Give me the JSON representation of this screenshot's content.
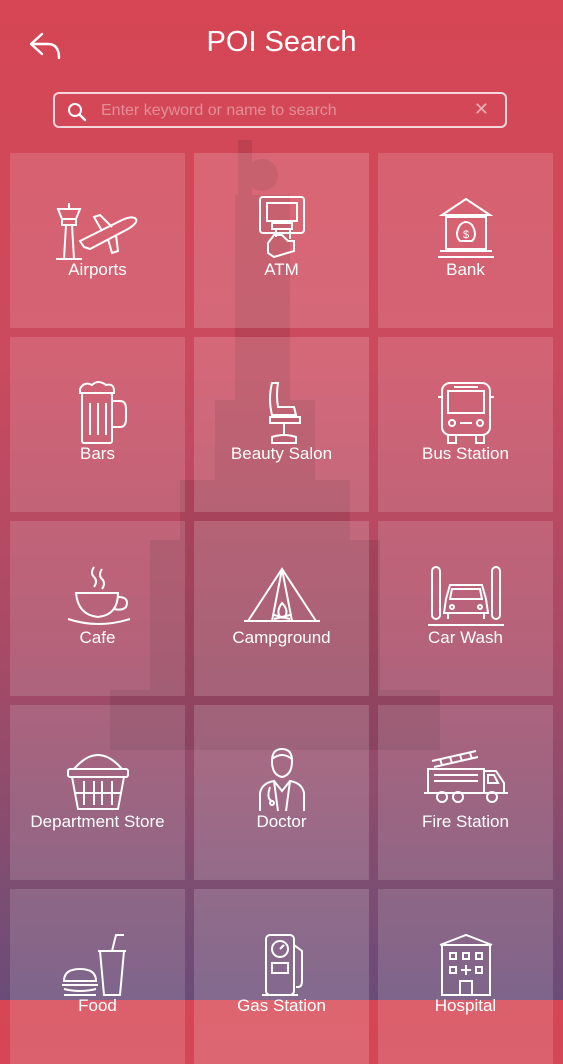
{
  "header": {
    "title": "POI Search"
  },
  "search": {
    "placeholder": "Enter keyword or name to search",
    "clear_label": "✕"
  },
  "categories": [
    {
      "label": "Airports",
      "icon": "airport-icon"
    },
    {
      "label": "ATM",
      "icon": "atm-icon"
    },
    {
      "label": "Bank",
      "icon": "bank-icon"
    },
    {
      "label": "Bars",
      "icon": "beer-mug-icon"
    },
    {
      "label": "Beauty Salon",
      "icon": "salon-chair-icon"
    },
    {
      "label": "Bus Station",
      "icon": "bus-icon"
    },
    {
      "label": "Cafe",
      "icon": "coffee-cup-icon"
    },
    {
      "label": "Campground",
      "icon": "tent-icon"
    },
    {
      "label": "Car Wash",
      "icon": "car-wash-icon"
    },
    {
      "label": "Department Store",
      "icon": "basket-icon"
    },
    {
      "label": "Doctor",
      "icon": "doctor-icon"
    },
    {
      "label": "Fire Station",
      "icon": "fire-truck-icon"
    },
    {
      "label": "Food",
      "icon": "fast-food-icon"
    },
    {
      "label": "Gas Station",
      "icon": "gas-pump-icon"
    },
    {
      "label": "Hospital",
      "icon": "hospital-icon"
    }
  ]
}
